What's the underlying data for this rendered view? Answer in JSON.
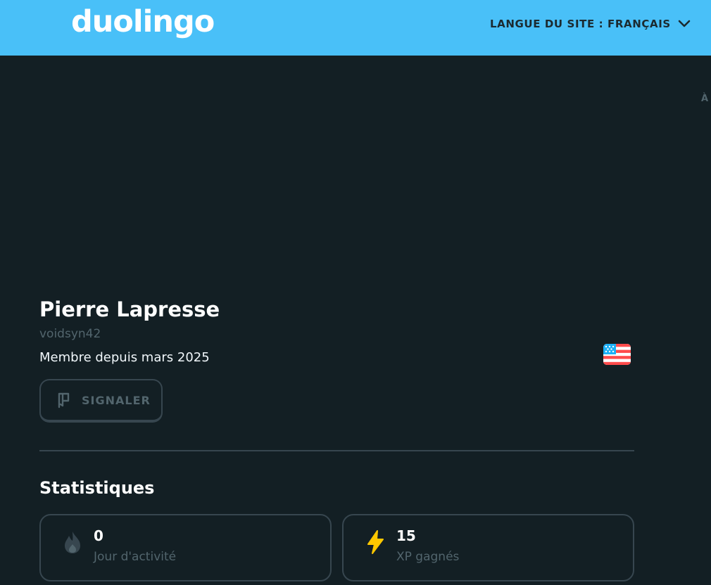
{
  "header": {
    "logo": "duolingo",
    "language_label": "LANGUE DU SITE : FRANÇAIS",
    "edge_text": "À"
  },
  "profile": {
    "name": "Pierre Lapresse",
    "username": "voidsyn42",
    "member_since": "Membre depuis mars 2025",
    "report_label": "SIGNALER"
  },
  "statistics": {
    "title": "Statistiques",
    "cards": [
      {
        "value": "0",
        "label": "Jour d'activité",
        "icon": "fire-icon"
      },
      {
        "value": "15",
        "label": "XP gagnés",
        "icon": "lightning-icon"
      }
    ]
  },
  "colors": {
    "header_bg": "#49c0f8",
    "page_bg": "#131f24",
    "muted_text": "#52656d",
    "border": "#37464f",
    "xp_yellow": "#ffc800"
  }
}
